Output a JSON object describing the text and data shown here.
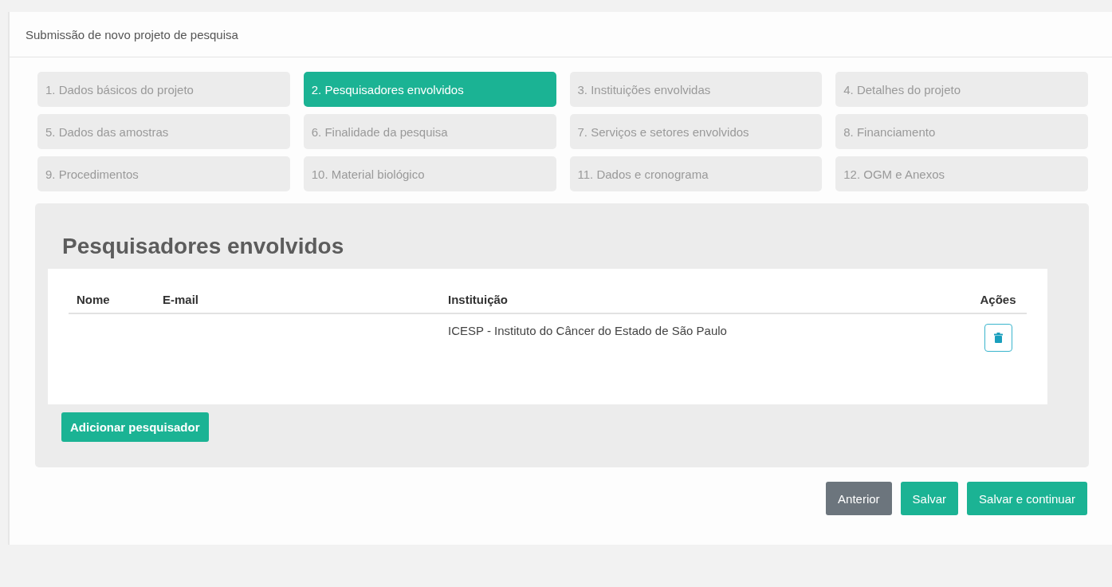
{
  "header": {
    "title": "Submissão de novo projeto de pesquisa"
  },
  "steps": [
    {
      "label": "1. Dados básicos do projeto",
      "selected": false
    },
    {
      "label": "2. Pesquisadores envolvidos",
      "selected": true
    },
    {
      "label": "3. Instituições envolvidas",
      "selected": false
    },
    {
      "label": "4. Detalhes do projeto",
      "selected": false
    },
    {
      "label": "5. Dados das amostras",
      "selected": false
    },
    {
      "label": "6. Finalidade da pesquisa",
      "selected": false
    },
    {
      "label": "7. Serviços e setores envolvidos",
      "selected": false
    },
    {
      "label": "8. Financiamento",
      "selected": false
    },
    {
      "label": "9. Procedimentos",
      "selected": false
    },
    {
      "label": "10. Material biológico",
      "selected": false
    },
    {
      "label": "11. Dados e cronograma",
      "selected": false
    },
    {
      "label": "12. OGM e Anexos",
      "selected": false
    }
  ],
  "section": {
    "title": "Pesquisadores envolvidos",
    "table": {
      "columns": [
        "Nome",
        "E-mail",
        "Instituição",
        "Ações"
      ],
      "rows": [
        {
          "institution": "ICESP - Instituto do Câncer do Estado de São Paulo"
        }
      ]
    },
    "add_button": "Adicionar pesquisador"
  },
  "footer_buttons": [
    {
      "label": "Anterior",
      "kind": "secondary"
    },
    {
      "label": "Salvar",
      "kind": "primary"
    },
    {
      "label": "Salvar e continuar",
      "kind": "primary"
    }
  ]
}
